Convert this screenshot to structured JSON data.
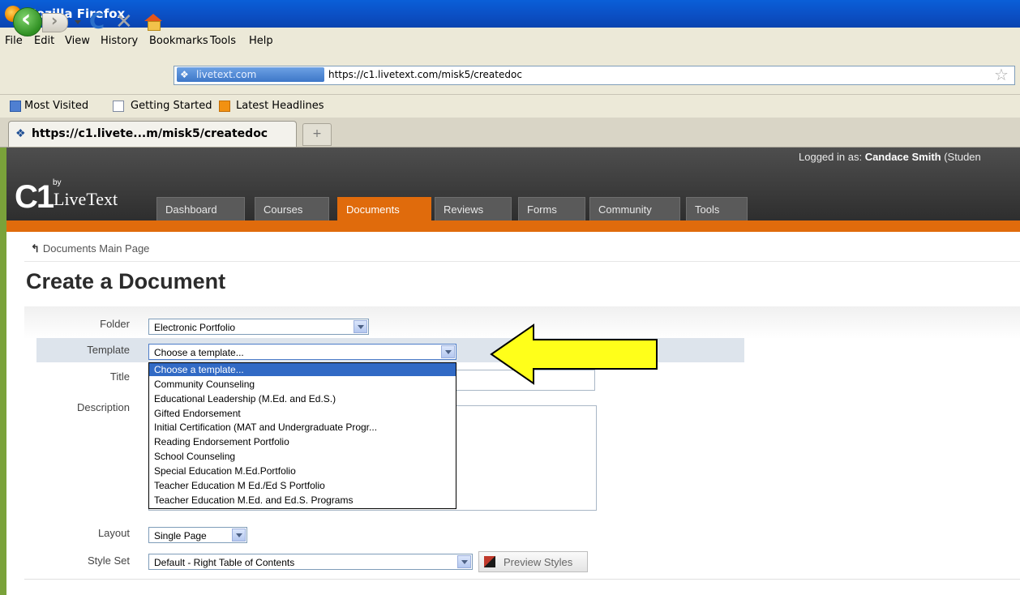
{
  "window": {
    "title": "Mozilla Firefox"
  },
  "menu": [
    "File",
    "Edit",
    "View",
    "History",
    "Bookmarks",
    "Tools",
    "Help"
  ],
  "urlbar": {
    "site_badge": "livetext.com",
    "url": "https://c1.livetext.com/misk5/createdoc"
  },
  "bookmarks": [
    "Most Visited",
    "Getting Started",
    "Latest Headlines"
  ],
  "browser_tab": {
    "title": "https://c1.livete...m/misk5/createdoc",
    "new_tab": "+"
  },
  "site": {
    "logged_in_prefix": "Logged in as: ",
    "user_name": "Candace Smith",
    "user_role": " (Studen",
    "logo_c1": "C1",
    "logo_by": "by",
    "logo_name": "LiveText",
    "nav": [
      "Dashboard",
      "Courses",
      "Documents",
      "Reviews",
      "Forms",
      "Community",
      "Tools"
    ],
    "active_nav": "Documents"
  },
  "page": {
    "breadcrumb": "Documents Main Page",
    "title": "Create a Document"
  },
  "form": {
    "folder_label": "Folder",
    "folder_value": "Electronic Portfolio",
    "template_label": "Template",
    "template_value": "Choose a template...",
    "title_label": "Title",
    "description_label": "Description",
    "layout_label": "Layout",
    "layout_value": "Single Page",
    "style_set_label": "Style Set",
    "style_set_value": "Default - Right Table of Contents",
    "preview_styles": "Preview Styles"
  },
  "template_options": [
    "Choose a template...",
    "Community Counseling",
    "Educational Leadership (M.Ed. and Ed.S.)",
    "Gifted Endorsement",
    "Initial Certification (MAT and Undergraduate Progr...",
    "Reading Endorsement Portfolio",
    "School Counseling",
    "Special Education M.Ed.Portfolio",
    "Teacher Education M Ed./Ed S Portfolio",
    "Teacher Education M.Ed. and Ed.S. Programs"
  ],
  "colors": {
    "accent_orange": "#e06b0c",
    "header_dark": "#3a3a3a",
    "highlight_yellow": "#ffff1a",
    "selection_blue": "#316ac5"
  },
  "icons": {
    "back": "back-arrow-icon",
    "forward": "forward-arrow-icon",
    "reload": "reload-icon",
    "stop": "stop-icon",
    "home": "home-icon",
    "star": "bookmark-star-icon",
    "breadcrumb": "up-arrow-icon",
    "preview": "palette-icon"
  }
}
